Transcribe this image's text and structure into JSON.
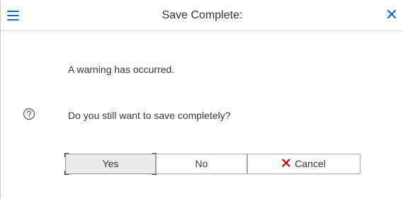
{
  "header": {
    "title": "Save Complete:",
    "menu_icon": "hamburger-menu-icon",
    "close_icon": "close-icon"
  },
  "body": {
    "warning_text": "A warning has occurred.",
    "question_text": "Do you still want to save completely?",
    "question_icon": "help-circle-icon"
  },
  "buttons": {
    "yes_label": "Yes",
    "no_label": "No",
    "cancel_label": "Cancel",
    "cancel_icon": "cancel-x-icon"
  },
  "colors": {
    "accent": "#0a6ed1",
    "cancel_icon": "#bb0000",
    "text": "#32363a"
  }
}
